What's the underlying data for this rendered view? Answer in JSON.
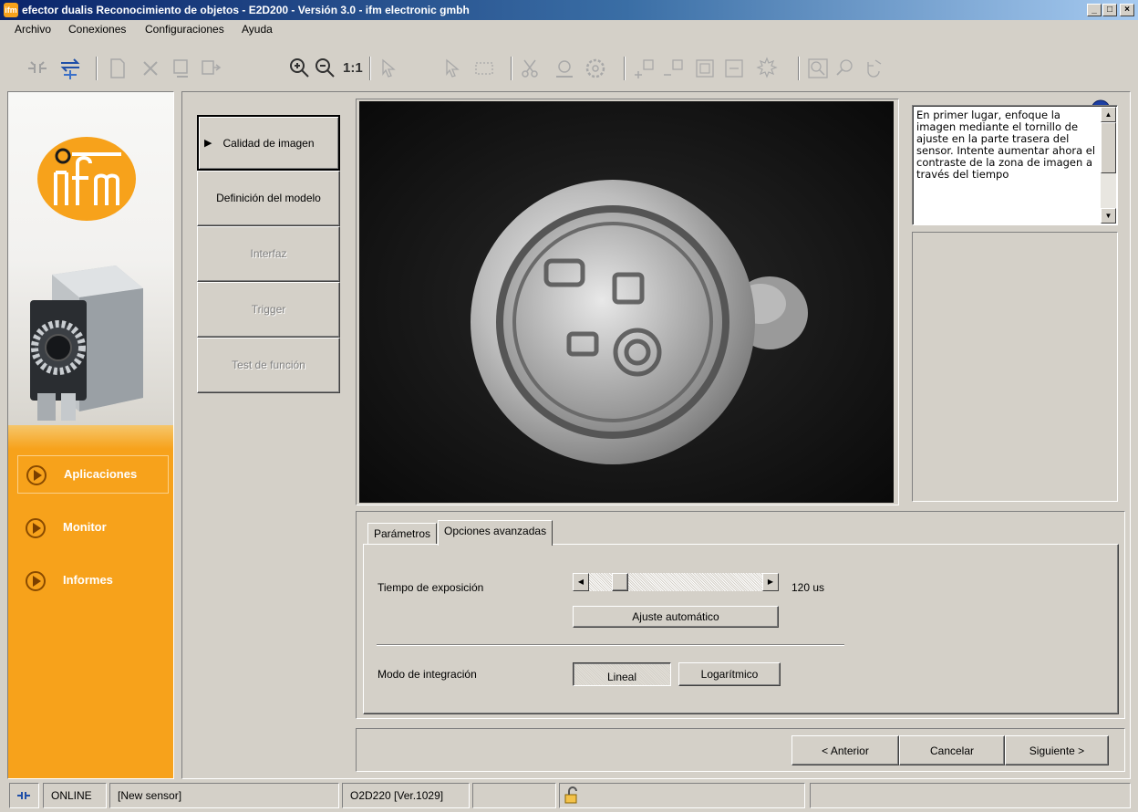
{
  "window": {
    "app_icon_text": "ifm",
    "title": "efector dualis Reconocimiento de objetos - E2D200 - Versión 3.0 - ifm electronic gmbh",
    "minimize": "_",
    "maximize": "□",
    "close": "×"
  },
  "menu": [
    "Archivo",
    "Conexiones",
    "Configuraciones",
    "Ayuda"
  ],
  "toolbar": {
    "zoom_one_to_one": "1:1",
    "help": "?"
  },
  "sidebar": {
    "logo": "ifm",
    "items": [
      {
        "label": "Aplicaciones",
        "selected": true
      },
      {
        "label": "Monitor",
        "selected": false
      },
      {
        "label": "Informes",
        "selected": false
      }
    ]
  },
  "steps": [
    {
      "label": "Calidad de imagen",
      "state": "active",
      "marker": "▶"
    },
    {
      "label": "Definición del modelo",
      "state": "enabled"
    },
    {
      "label": "Interfaz",
      "state": "disabled"
    },
    {
      "label": "Trigger",
      "state": "disabled"
    },
    {
      "label": "Test de función",
      "state": "disabled"
    }
  ],
  "help": {
    "text": "En primer lugar, enfoque la imagen mediante el tornillo de ajuste en la parte trasera del sensor. Intente aumentar ahora el contraste de la zona de imagen a través del tiempo",
    "scroll_up": "▲",
    "scroll_down": "▼"
  },
  "tabs": [
    {
      "label": "Parámetros",
      "active": false
    },
    {
      "label": "Opciones avanzadas",
      "active": true
    }
  ],
  "exposure": {
    "label": "Tiempo de exposición",
    "value_text": "120 us",
    "slider_fraction": 0.16,
    "left_arrow": "◀",
    "right_arrow": "▶",
    "auto_button": "Ajuste automático"
  },
  "integration": {
    "label": "Modo de integración",
    "options": [
      "Lineal",
      "Logarítmico"
    ],
    "selected": "Lineal"
  },
  "nav_buttons": {
    "previous": "< Anterior",
    "cancel": "Cancelar",
    "next": "Siguiente >"
  },
  "status": {
    "connection": "ONLINE",
    "sensor_name": "[New sensor]",
    "device": "O2D220  [Ver.1029]"
  },
  "colors": {
    "ifm_orange": "#f7a21b",
    "title_blue": "#0a246a",
    "face": "#d4d0c8"
  }
}
